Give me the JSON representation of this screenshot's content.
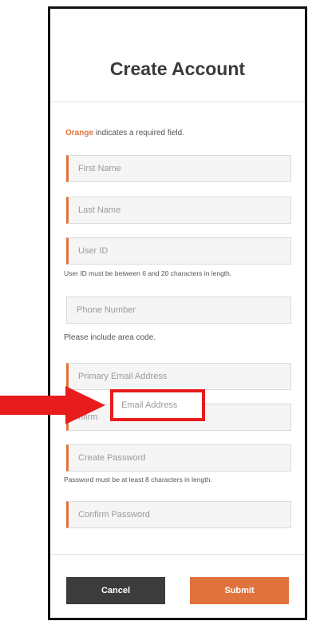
{
  "form": {
    "title": "Create Account",
    "required_note_highlight": "Orange",
    "required_note_rest": " indicates a required field.",
    "fields": {
      "first_name": "First Name",
      "last_name": "Last Name",
      "user_id": "User ID",
      "phone_number": "Phone Number",
      "primary_email": "Primary Email Address",
      "confirm_email_partial": "nfirm",
      "create_password": "Create Password",
      "confirm_password": "Confirm Password"
    },
    "hints": {
      "user_id": "User ID must be between 6 and 20 characters in length.",
      "phone": "Please include area code.",
      "password": "Password must be at least 8 characters in length."
    },
    "buttons": {
      "cancel": "Cancel",
      "submit": "Submit"
    }
  },
  "annotation": {
    "highlight_text": "Email Address",
    "arrow_color": "#e81c1c",
    "accent_color": "#e0733d"
  }
}
